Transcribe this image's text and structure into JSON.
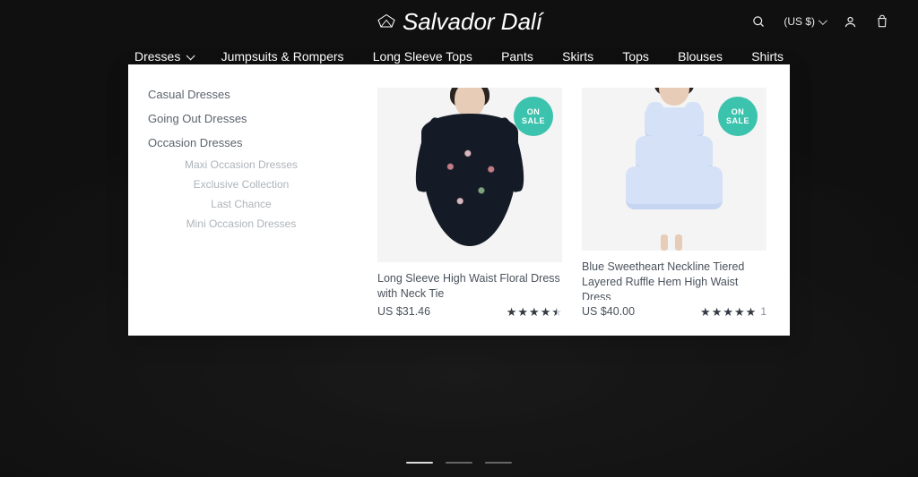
{
  "brand": "Salvador Dalí",
  "currency_label": "(US $)",
  "nav": {
    "items": [
      "Dresses",
      "Jumpsuits & Rompers",
      "Long Sleeve Tops",
      "Pants",
      "Skirts",
      "Tops",
      "Blouses",
      "Shirts"
    ],
    "active_index": 0
  },
  "mega": {
    "categories": [
      "Casual Dresses",
      "Going Out Dresses",
      "Occasion Dresses"
    ],
    "occasion_sub": [
      "Maxi Occasion Dresses",
      "Exclusive Collection",
      "Last Chance",
      "Mini Occasion Dresses"
    ]
  },
  "sale_badge": "ON\nSALE",
  "products": [
    {
      "title": "Long Sleeve High Waist Floral Dress with Neck Tie",
      "price": "US $31.46",
      "rating": 4.5,
      "reviews": null,
      "on_sale": true
    },
    {
      "title": "Blue Sweetheart Neckline Tiered Layered Ruffle Hem High Waist Dress",
      "price": "US $40.00",
      "rating": 5,
      "reviews": "1",
      "on_sale": true
    }
  ],
  "carousel": {
    "slides": 3,
    "active": 0
  }
}
